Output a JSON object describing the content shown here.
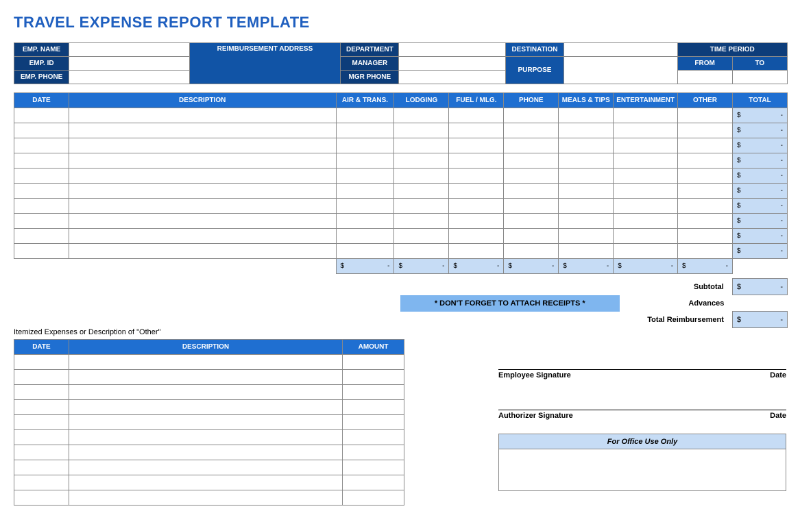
{
  "title": "TRAVEL EXPENSE REPORT TEMPLATE",
  "info": {
    "emp_name": "EMP. NAME",
    "emp_id": "EMP. ID",
    "emp_phone": "EMP. PHONE",
    "reimb_addr": "REIMBURSEMENT ADDRESS",
    "department": "DEPARTMENT",
    "manager": "MANAGER",
    "mgr_phone": "MGR PHONE",
    "destination": "DESTINATION",
    "purpose": "PURPOSE",
    "time_period": "TIME PERIOD",
    "from": "FROM",
    "to": "TO"
  },
  "main": {
    "headers": [
      "DATE",
      "DESCRIPTION",
      "AIR & TRANS.",
      "LODGING",
      "FUEL / MLG.",
      "PHONE",
      "MEALS & TIPS",
      "ENTERTAINMENT",
      "OTHER",
      "TOTAL"
    ],
    "row_count": 10,
    "money": {
      "sym": "$",
      "dash": "-"
    },
    "sums_cols": 7,
    "subtotal": "Subtotal",
    "advances": "Advances",
    "total_reimb": "Total Reimbursement",
    "receipt_note": "* DON'T FORGET TO ATTACH RECEIPTS *"
  },
  "itemized": {
    "label": "Itemized Expenses or Description of \"Other\"",
    "headers": [
      "DATE",
      "DESCRIPTION",
      "AMOUNT"
    ],
    "row_count": 10
  },
  "sig": {
    "emp": "Employee Signature",
    "auth": "Authorizer Signature",
    "date": "Date",
    "office": "For Office Use Only"
  }
}
